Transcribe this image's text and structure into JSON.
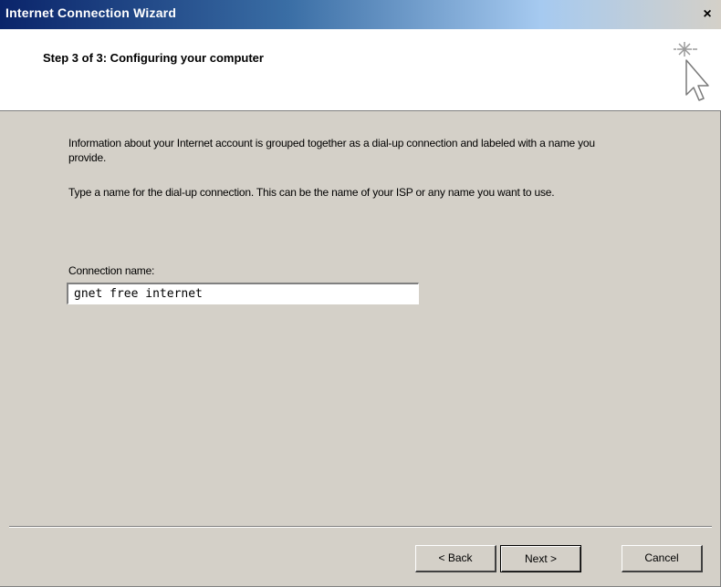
{
  "window": {
    "title": "Internet Connection Wizard",
    "close_glyph": "×"
  },
  "header": {
    "step_title": "Step 3 of 3: Configuring your computer",
    "icon": "wizard-cursor-sparkle-icon"
  },
  "content": {
    "paragraph1": "Information about your Internet account is grouped together as a dial-up connection and labeled with a name you provide.",
    "paragraph2": "Type a name for the dial-up connection. This can be the name of your ISP or any name you want to use.",
    "connection_label": "Connection name:",
    "connection_value": "gnet free internet"
  },
  "buttons": {
    "back": "< Back",
    "next": "Next >",
    "cancel": "Cancel"
  },
  "colors": {
    "title_gradient_start": "#0a246a",
    "dialog_bg": "#d4d0c8",
    "header_bg": "#ffffff"
  }
}
